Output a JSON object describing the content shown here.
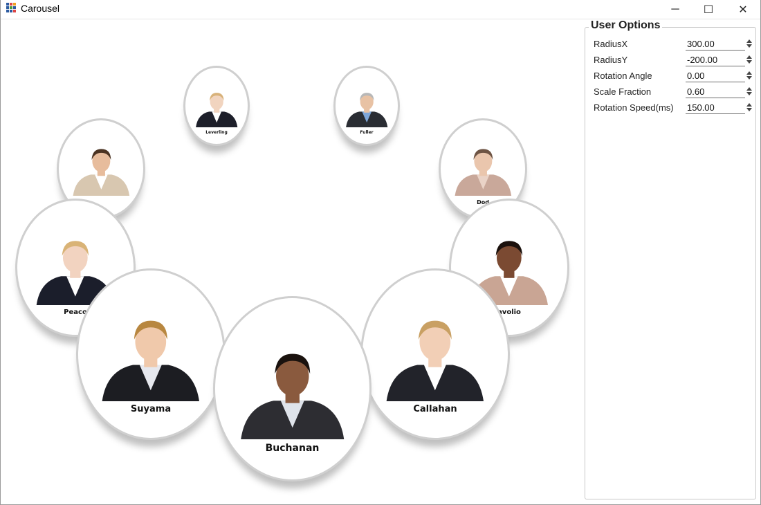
{
  "window": {
    "title": "Carousel",
    "icon": "app-grid-icon",
    "controls": {
      "minimize": "─",
      "maximize": "☐",
      "close": "✕"
    }
  },
  "carousel": {
    "cards": [
      {
        "name": "Leverling",
        "skin": "#f1d4bf",
        "hair": "#d8b27a",
        "suit": "#1d1f2a",
        "shirt": "#ffffff"
      },
      {
        "name": "Fuller",
        "skin": "#e8c2a4",
        "hair": "#b8b8b8",
        "suit": "#2a2d33",
        "shirt": "#7ea6d8"
      },
      {
        "name": "",
        "skin": "#e7bc9c",
        "hair": "#4b3322",
        "suit": "#d8c7b0",
        "shirt": "#ffffff"
      },
      {
        "name": "Dod",
        "skin": "#eac6ad",
        "hair": "#6e5444",
        "suit": "#c9a89a",
        "shirt": "#ead3c7"
      },
      {
        "name": "Peaco",
        "skin": "#f2d3c0",
        "hair": "#d9b376",
        "suit": "#1b1e2b",
        "shirt": "#ffffff"
      },
      {
        "name": "avolio",
        "skin": "#7b4a32",
        "hair": "#1b110d",
        "suit": "#c9a594",
        "shirt": "#ffffff"
      },
      {
        "name": "Suyama",
        "skin": "#f0c9ab",
        "hair": "#b88740",
        "suit": "#1c1d22",
        "shirt": "#e6e8ee"
      },
      {
        "name": "Callahan",
        "skin": "#f2cfb6",
        "hair": "#c9a063",
        "suit": "#22232a",
        "shirt": "#ffffff"
      },
      {
        "name": "Buchanan",
        "skin": "#8a5a3e",
        "hair": "#1a120e",
        "suit": "#2d2d32",
        "shirt": "#dfe3ea"
      }
    ]
  },
  "options": {
    "title": "User Options",
    "rows": [
      {
        "label": "RadiusX",
        "value": "300.00"
      },
      {
        "label": "RadiusY",
        "value": "-200.00"
      },
      {
        "label": "Rotation Angle",
        "value": "0.00"
      },
      {
        "label": "Scale Fraction",
        "value": "0.60"
      },
      {
        "label": "Rotation Speed(ms)",
        "value": "150.00"
      }
    ]
  },
  "colors": {
    "app_icon": [
      "#2c5aa0",
      "#d44",
      "#f0a020",
      "#2c5aa0",
      "#4a9a3a",
      "#2c5aa0",
      "#2c5aa0",
      "#2c5aa0",
      "#d44"
    ]
  }
}
